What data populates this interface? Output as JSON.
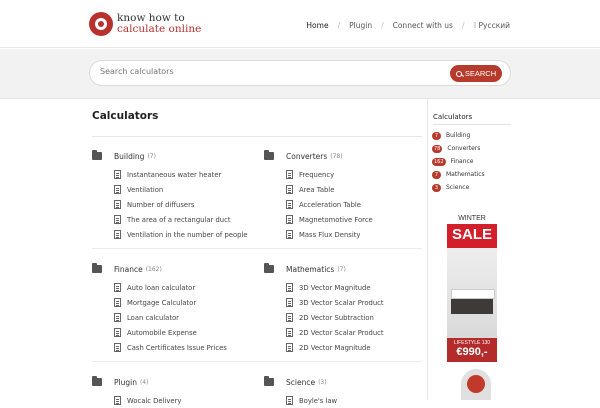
{
  "header": {
    "logo_line1": "know how to",
    "logo_line2": "calculate online",
    "nav": [
      {
        "label": "Home"
      },
      {
        "label": "Plugin"
      },
      {
        "label": "Connect with us"
      },
      {
        "label": "Русский"
      }
    ]
  },
  "search": {
    "placeholder": "Search calculators",
    "button_label": "SEARCH"
  },
  "main": {
    "title": "Calculators",
    "categories": [
      {
        "name": "Building",
        "count": "(7)",
        "links": [
          "Instantaneous water heater",
          "Ventilation",
          "Number of diffusers",
          "The area of a rectangular duct",
          "Ventilation in the number of people"
        ]
      },
      {
        "name": "Converters",
        "count": "(78)",
        "links": [
          "Frequency",
          "Area Table",
          "Acceleration Table",
          "Magnetomotive Force",
          "Mass Flux Density"
        ]
      },
      {
        "name": "Finance",
        "count": "(162)",
        "links": [
          "Auto loan calculator",
          "Mortgage Calculator",
          "Loan calculator",
          "Automobile Expense",
          "Cash Certificates Issue Prices"
        ]
      },
      {
        "name": "Mathematics",
        "count": "(7)",
        "links": [
          "3D Vector Magnitude",
          "3D Vector Scalar Product",
          "2D Vector Subtraction",
          "2D Vector Scalar Product",
          "2D Vector Magnitude"
        ]
      },
      {
        "name": "Plugin",
        "count": "(4)",
        "links": [
          "Wocalc Delivery"
        ]
      },
      {
        "name": "Science",
        "count": "(3)",
        "links": [
          "Boyle's law"
        ]
      }
    ]
  },
  "sidebar": {
    "title": "Calculators",
    "items": [
      {
        "badge": "7",
        "label": "Building"
      },
      {
        "badge": "78",
        "label": "Converters"
      },
      {
        "badge": "162",
        "label": "Finance"
      },
      {
        "badge": "7",
        "label": "Mathematics"
      },
      {
        "badge": "3",
        "label": "Science"
      }
    ],
    "ad": {
      "top": "WINTER",
      "sale": "SALE",
      "lifestyle": "LIFESTYLE 130",
      "price": "€990,-"
    }
  },
  "colors": {
    "accent": "#b63b2c"
  }
}
